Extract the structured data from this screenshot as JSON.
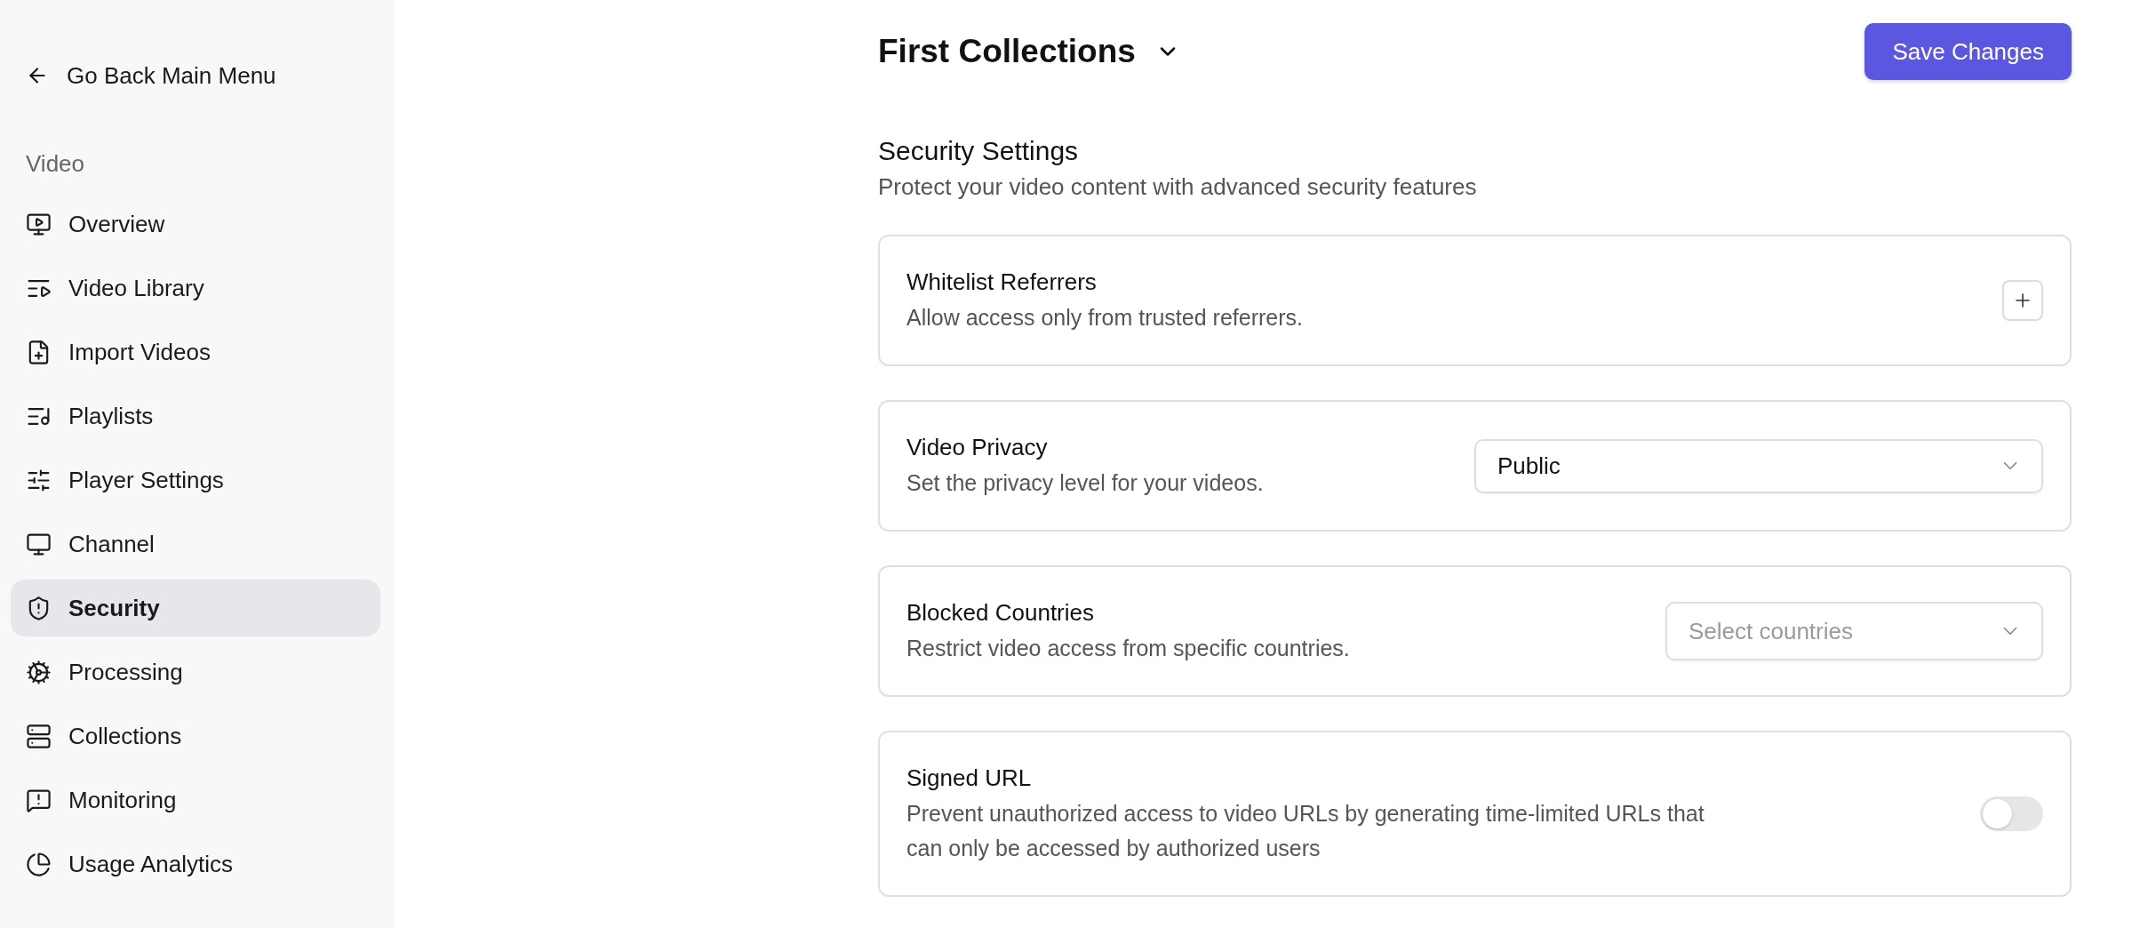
{
  "sidebar": {
    "back_link": {
      "label": "Go Back Main Menu"
    },
    "section_label": "Video",
    "items": [
      {
        "label": "Overview",
        "selected": false
      },
      {
        "label": "Video Library",
        "selected": false
      },
      {
        "label": "Import Videos",
        "selected": false
      },
      {
        "label": "Playlists",
        "selected": false
      },
      {
        "label": "Player Settings",
        "selected": false
      },
      {
        "label": "Channel",
        "selected": false
      },
      {
        "label": "Security",
        "selected": true
      },
      {
        "label": "Processing",
        "selected": false
      },
      {
        "label": "Collections",
        "selected": false
      },
      {
        "label": "Monitoring",
        "selected": false
      },
      {
        "label": "Usage Analytics",
        "selected": false
      }
    ]
  },
  "header": {
    "title": "First Collections",
    "save_button": "Save Changes"
  },
  "section": {
    "title": "Security Settings",
    "subtitle": "Protect your video content with advanced security features"
  },
  "settings": [
    {
      "kind": "add",
      "title": "Whitelist Referrers",
      "description": "Allow access only from trusted referrers."
    },
    {
      "kind": "select",
      "title": "Video Privacy",
      "description": "Set the privacy level for your videos.",
      "value": "Public"
    },
    {
      "kind": "select",
      "title": "Blocked Countries",
      "description": "Restrict video access from specific countries.",
      "placeholder": "Select countries"
    },
    {
      "kind": "toggle",
      "title": "Signed URL",
      "description": "Prevent unauthorized access to video URLs by generating time-limited URLs that can only be accessed by authorized users",
      "on": false
    }
  ]
}
